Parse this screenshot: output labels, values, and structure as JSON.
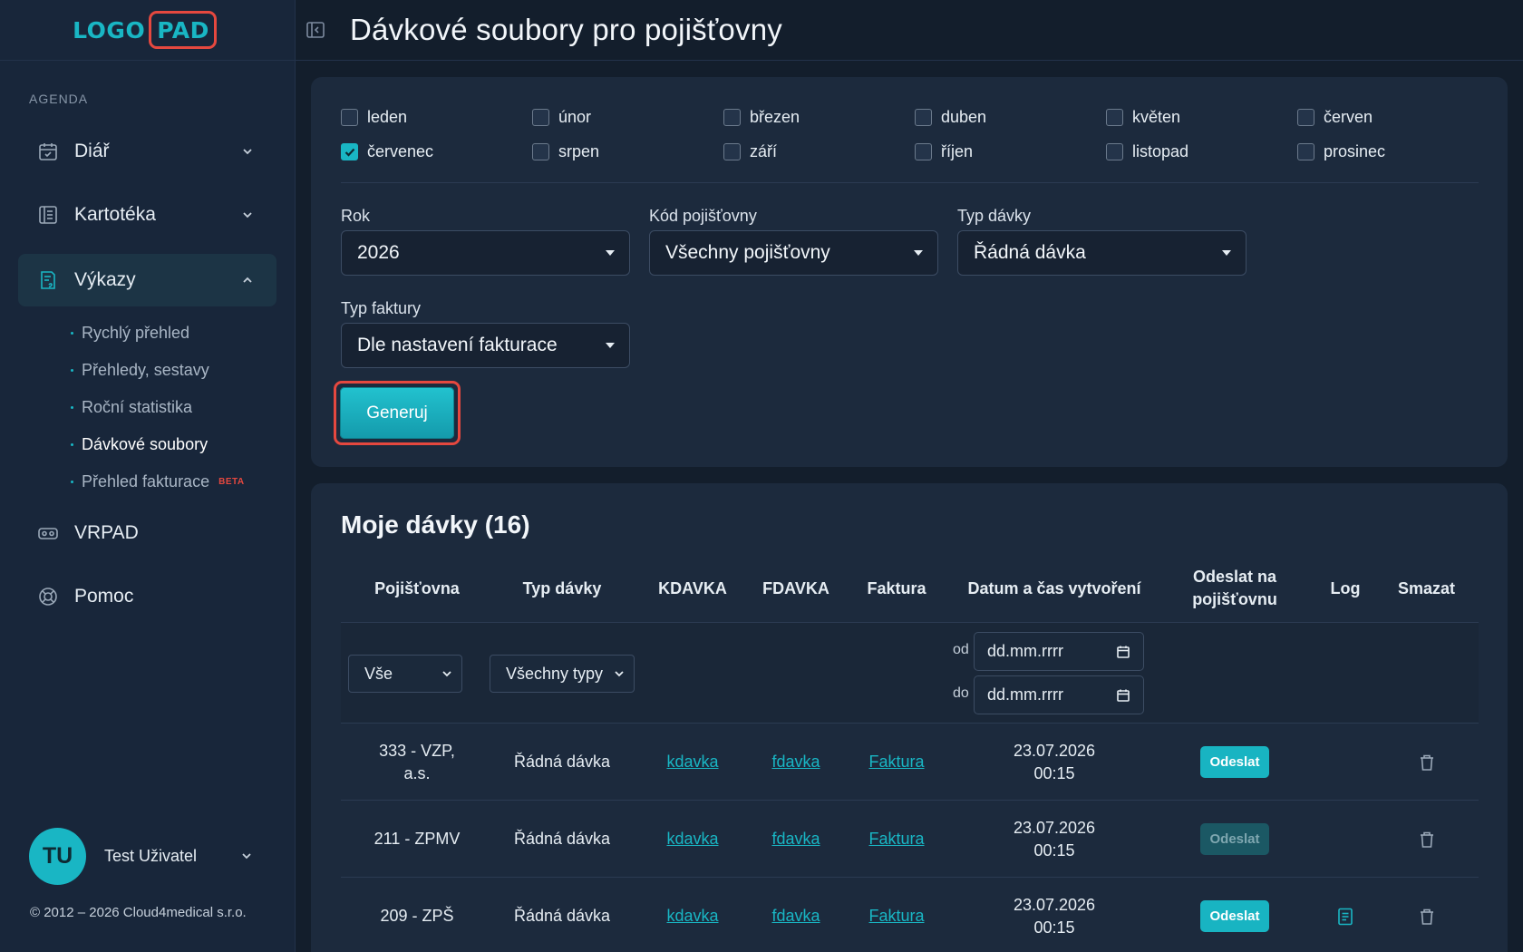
{
  "app": {
    "logo_left": "LOGO",
    "logo_right": "PAD",
    "page_title": "Dávkové soubory pro pojišťovny"
  },
  "sidebar": {
    "section_label": "AGENDA",
    "items": [
      {
        "label": "Diář",
        "icon": "calendar-icon",
        "expanded": false
      },
      {
        "label": "Kartotéka",
        "icon": "folder-icon",
        "expanded": false
      },
      {
        "label": "Výkazy",
        "icon": "report-icon",
        "expanded": true
      },
      {
        "label": "VRPAD",
        "icon": "vr-headset-icon"
      },
      {
        "label": "Pomoc",
        "icon": "lifebuoy-icon"
      }
    ],
    "sub_items": [
      {
        "label": "Rychlý přehled"
      },
      {
        "label": "Přehledy, sestavy"
      },
      {
        "label": "Roční statistika"
      },
      {
        "label": "Dávkové soubory"
      },
      {
        "label": "Přehled fakturace",
        "badge": "BETA"
      }
    ],
    "user": {
      "initials": "TU",
      "name": "Test Uživatel"
    },
    "copyright": "© 2012 – 2026 Cloud4medical s.r.o."
  },
  "filters": {
    "months": [
      {
        "label": "leden",
        "checked": false
      },
      {
        "label": "únor",
        "checked": false
      },
      {
        "label": "březen",
        "checked": false
      },
      {
        "label": "duben",
        "checked": false
      },
      {
        "label": "květen",
        "checked": false
      },
      {
        "label": "červen",
        "checked": false
      },
      {
        "label": "červenec",
        "checked": true
      },
      {
        "label": "srpen",
        "checked": false
      },
      {
        "label": "září",
        "checked": false
      },
      {
        "label": "říjen",
        "checked": false
      },
      {
        "label": "listopad",
        "checked": false
      },
      {
        "label": "prosinec",
        "checked": false
      }
    ],
    "year_label": "Rok",
    "year_value": "2026",
    "insurer_label": "Kód pojišťovny",
    "insurer_value": "Všechny pojišťovny",
    "batch_type_label": "Typ dávky",
    "batch_type_value": "Řádná dávka",
    "invoice_type_label": "Typ faktury",
    "invoice_type_value": "Dle nastavení fakturace",
    "generate_label": "Generuj"
  },
  "batches": {
    "title": "Moje dávky (16)",
    "columns": [
      "Pojišťovna",
      "Typ dávky",
      "KDAVKA",
      "FDAVKA",
      "Faktura",
      "Datum a čas vytvoření",
      "Odeslat na pojišťovnu",
      "Log",
      "Smazat"
    ],
    "filter": {
      "insurer_value": "Vše",
      "type_value": "Všechny typy",
      "from_label": "od",
      "to_label": "do",
      "from_placeholder": "dd.mm.rrrr",
      "to_placeholder": "dd.mm.rrrr"
    },
    "rows": [
      {
        "insurer": "333 - VZP, a.s.",
        "type": "Řádná dávka",
        "kdavka": "kdavka",
        "fdavka": "fdavka",
        "invoice": "Faktura",
        "date": "23.07.2026",
        "time": "00:15",
        "send": "Odeslat",
        "send_enabled": true,
        "has_log": false
      },
      {
        "insurer": "211 - ZPMV",
        "type": "Řádná dávka",
        "kdavka": "kdavka",
        "fdavka": "fdavka",
        "invoice": "Faktura",
        "date": "23.07.2026",
        "time": "00:15",
        "send": "Odeslat",
        "send_enabled": false,
        "has_log": false
      },
      {
        "insurer": "209 - ZPŠ",
        "type": "Řádná dávka",
        "kdavka": "kdavka",
        "fdavka": "fdavka",
        "invoice": "Faktura",
        "date": "23.07.2026",
        "time": "00:15",
        "send": "Odeslat",
        "send_enabled": true,
        "has_log": true
      }
    ]
  },
  "colors": {
    "accent": "#19b6c4",
    "highlight": "#e5483f",
    "background": "#131e2c"
  }
}
